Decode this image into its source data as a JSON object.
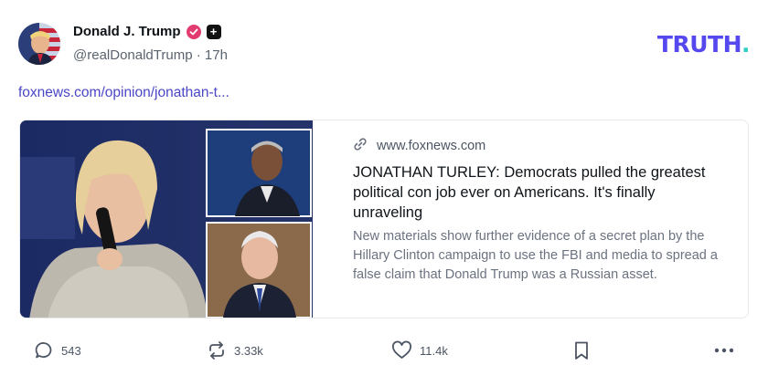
{
  "post": {
    "author": {
      "display_name": "Donald J. Trump",
      "handle": "@realDonaldTrump",
      "time_ago": "17h",
      "separator": "·"
    },
    "brand": {
      "logo_text": "TRUTH",
      "logo_dot": "."
    },
    "link_text": "foxnews.com/opinion/jonathan-t...",
    "card": {
      "domain": "www.foxnews.com",
      "title": "JONATHAN TURLEY: Democrats pulled the greatest political con job ever on Americans. It's finally unraveling",
      "description": "New materials show further evidence of a secret plan by the Hillary Clinton campaign to use the FBI and media to spread a false claim that Donald Trump was a Russian asset."
    },
    "actions": {
      "replies": "543",
      "retruths": "3.33k",
      "likes": "11.4k"
    }
  },
  "colors": {
    "brand_purple": "#5448ee",
    "brand_teal": "#2fd0c4",
    "verified_pink": "#e23b6f",
    "link": "#4a46c7"
  },
  "icons": {
    "verified": "verified-check-icon",
    "plus": "plus-badge-icon",
    "link": "link-chain-icon",
    "reply": "speech-bubble-icon",
    "retruth": "repost-arrows-icon",
    "like": "heart-icon",
    "bookmark": "bookmark-icon",
    "more": "more-dots-icon"
  }
}
